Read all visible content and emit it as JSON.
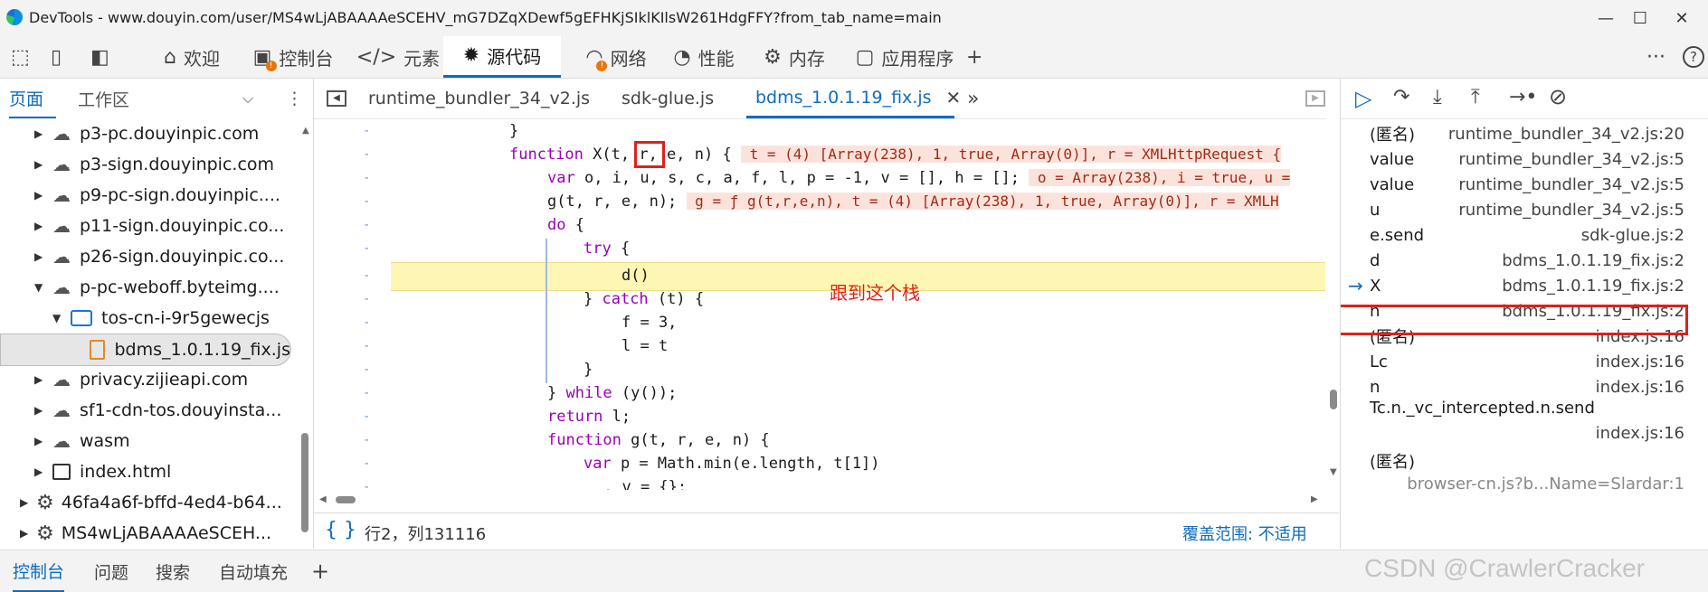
{
  "window": {
    "title": "DevTools - www.douyin.com/user/MS4wLjABAAAAeSCEHV_mG7DZqXDewf5gEFHKjSIklKIlsW261HdgFFY?from_tab_name=main"
  },
  "toolbar": {
    "tabs": [
      {
        "label": "欢迎",
        "icon": "home-icon"
      },
      {
        "label": "控制台",
        "icon": "console-icon"
      },
      {
        "label": "元素",
        "icon": "code-brackets-icon"
      },
      {
        "label": "源代码",
        "icon": "bug-icon"
      },
      {
        "label": "网络",
        "icon": "wifi-icon"
      },
      {
        "label": "性能",
        "icon": "gauge-icon"
      },
      {
        "label": "内存",
        "icon": "chip-icon"
      },
      {
        "label": "应用程序",
        "icon": "app-window-icon"
      }
    ],
    "add_label": "+",
    "more_label": "···",
    "help_label": "?"
  },
  "navigator": {
    "tabs": [
      "页面",
      "工作区"
    ],
    "tree": [
      {
        "label": "p3-pc.douyinpic.com",
        "type": "domain"
      },
      {
        "label": "p3-sign.douyinpic.com",
        "type": "domain"
      },
      {
        "label": "p9-pc-sign.douyinpic....",
        "type": "domain"
      },
      {
        "label": "p11-sign.douyinpic.co...",
        "type": "domain"
      },
      {
        "label": "p26-sign.douyinpic.co...",
        "type": "domain"
      },
      {
        "label": "p-pc-weboff.byteimg....",
        "type": "domain"
      },
      {
        "label": "tos-cn-i-9r5gewecjs",
        "type": "folder"
      },
      {
        "label": "bdms_1.0.1.19_fix.js",
        "type": "file"
      },
      {
        "label": "privacy.zijieapi.com",
        "type": "domain"
      },
      {
        "label": "sf1-cdn-tos.douyinsta...",
        "type": "domain"
      },
      {
        "label": "wasm",
        "type": "domain"
      },
      {
        "label": "index.html",
        "type": "page"
      },
      {
        "label": "46fa4a6f-bffd-4ed4-b64...",
        "type": "worker"
      },
      {
        "label": "MS4wLjABAAAAeSCEH...",
        "type": "worker"
      }
    ]
  },
  "editor": {
    "tabs": [
      "runtime_bundler_34_v2.js",
      "sdk-glue.js",
      "bdms_1.0.1.19_fix.js"
    ],
    "code": {
      "l0": "}",
      "l1_kw": "function",
      "l1_a": " X(t, ",
      "l1_r": "r",
      "l1_b": ", e, n) {",
      "l1_val": " t = (4) [Array(238), 1, true, Array(0)], r = XMLHttpRequest {",
      "l2_kw": "var",
      "l2_a": " o, i, u, s, c, a, f, l, p = -1, v = [], h = [];",
      "l2_val": " o = Array(238), i = true, u =",
      "l3_a": "g(t, r, e, n);",
      "l3_val": " g = ƒ g(t,r,e,n), t = (4) [Array(238), 1, true, Array(0)], r = XMLH",
      "l4_kw": "do",
      "l4_a": " {",
      "l5_kw": "try",
      "l5_a": " {",
      "l6_a": "d()",
      "l7_a": "} ",
      "l7_kw": "catch",
      "l7_b": " (t) {",
      "l8_a": "f = 3,",
      "l9_a": "l = t",
      "l10_a": "}",
      "l11_a": "} ",
      "l11_kw": "while",
      "l11_b": " (y());",
      "l12_kw": "return",
      "l12_a": " l;",
      "l13_kw": "function",
      "l13_a": " g(t, r, e, n) {",
      "l14_kw": "var",
      "l14_a": " p = Math.min(e.length, t[1])",
      "l15_a": ", v = {};"
    },
    "gutter_mark": "-",
    "annotation": "跟到这个栈",
    "status": {
      "braces": "{ }",
      "position": "行2，列131116",
      "coverage": "覆盖范围: 不适用"
    }
  },
  "callstack": {
    "frames": [
      {
        "name": "(匿名)",
        "location": "runtime_bundler_34_v2.js:20"
      },
      {
        "name": "value",
        "location": "runtime_bundler_34_v2.js:5"
      },
      {
        "name": "value",
        "location": "runtime_bundler_34_v2.js:5"
      },
      {
        "name": "u",
        "location": "runtime_bundler_34_v2.js:5"
      },
      {
        "name": "e.send",
        "location": "sdk-glue.js:2"
      },
      {
        "name": "d",
        "location": "bdms_1.0.1.19_fix.js:2"
      },
      {
        "name": "X",
        "location": "bdms_1.0.1.19_fix.js:2"
      },
      {
        "name": "n",
        "location": "bdms_1.0.1.19_fix.js:2"
      },
      {
        "name": "(匿名)",
        "location": "index.js:16"
      },
      {
        "name": "Lc",
        "location": "index.js:16"
      },
      {
        "name": "n",
        "location": "index.js:16"
      },
      {
        "name": "Tc.n._vc_intercepted.n.send",
        "location": "index.js:16"
      },
      {
        "name": "(匿名)",
        "location": "browser-cn.js?b...Name=Slardar:1"
      }
    ],
    "current_marker": "→"
  },
  "drawer": {
    "tabs": [
      "控制台",
      "问题",
      "搜索",
      "自动填充"
    ],
    "add_label": "+"
  },
  "watermark": "CSDN @CrawlerCracker",
  "colors": {
    "accent": "#0f6cbd",
    "highlight": "#fdf6b5",
    "annotation": "#e0201b"
  }
}
